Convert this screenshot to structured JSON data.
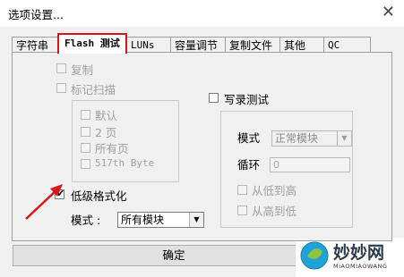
{
  "window": {
    "title": "选项设置...",
    "close_glyph": "✕"
  },
  "tabs": [
    {
      "label": "字符串"
    },
    {
      "label": "Flash 测试",
      "active": true
    },
    {
      "label": "LUNs"
    },
    {
      "label": "容量调节"
    },
    {
      "label": "复制文件"
    },
    {
      "label": "其他"
    },
    {
      "label": "QC"
    }
  ],
  "left": {
    "copy_label": "复制",
    "mark_scan_label": "标记扫描",
    "scan_options": [
      "默认",
      "2 页",
      "所有页",
      "517th Byte"
    ],
    "low_format_label": "低级格式化",
    "low_format_checked": true,
    "mode_label": "模式 :",
    "mode_value": "所有模块"
  },
  "right": {
    "write_test_label": "写录测试",
    "mode_label": "模式",
    "mode_value": "正常模块",
    "loop_label": "循环",
    "loop_value": "0",
    "low_to_high_label": "从低到高",
    "high_to_low_label": "从高到低"
  },
  "ok_label": "确定",
  "watermark": {
    "text": "妙妙网",
    "sub": "MIAOMIAOWANG"
  },
  "colors": {
    "highlight": "#d9141a",
    "arrow": "#d9141a"
  }
}
